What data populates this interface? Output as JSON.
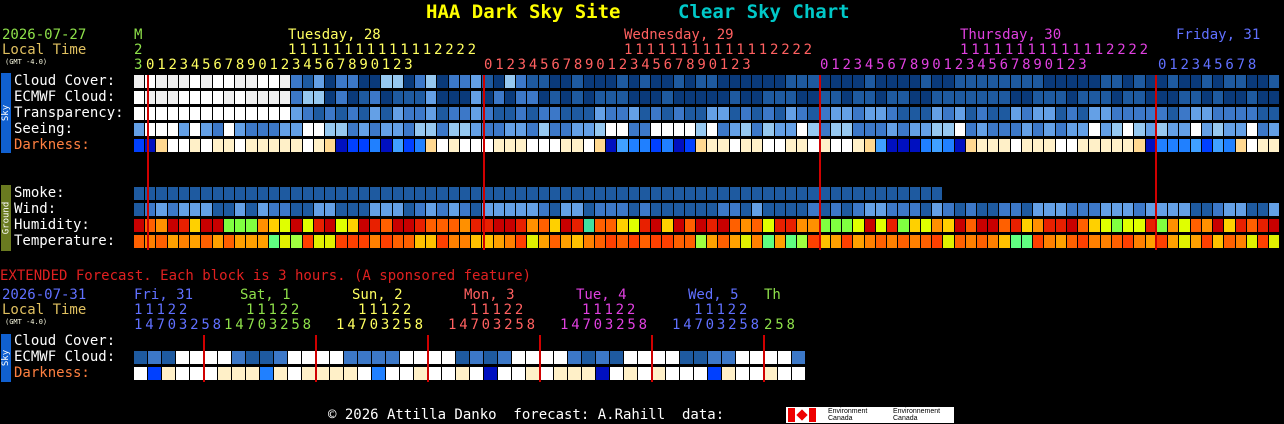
{
  "header": {
    "site_title": "HAA Dark Sky Site",
    "chart_title": "Clear Sky Chart",
    "title_color": "#ffff00",
    "chart_title_color": "#00c8c8"
  },
  "main": {
    "date": "2026-07-27",
    "local_time_label": "Local Time",
    "gmt_offset": "(GMT -4.0)",
    "day_labels": [
      {
        "text": "M",
        "color": "#8ee04a"
      },
      {
        "text": "Tuesday, 28",
        "color": "#ffff60"
      },
      {
        "text": "Wednesday, 29",
        "color": "#ff6060"
      },
      {
        "text": "Thursday, 30",
        "color": "#e040e0"
      },
      {
        "text": "Friday, 31",
        "color": "#6070ff"
      }
    ],
    "hour_tens": [
      {
        "text": "2",
        "color": "#8ee04a"
      },
      {
        "text": "11111111111112222",
        "color": "#ffff60"
      },
      {
        "text": "11111111111112222",
        "color": "#ff6060"
      },
      {
        "text": "11111111111112222",
        "color": "#e040e0"
      }
    ],
    "hour_ones": [
      {
        "text": "3",
        "color": "#8ee04a"
      },
      {
        "text": "012345678901234567890123",
        "color": "#ffff60"
      },
      {
        "text": "012345678901234567890123",
        "color": "#ff6060"
      },
      {
        "text": "012345678901234567890123",
        "color": "#e040e0"
      },
      {
        "text": "012345678",
        "color": "#6070ff"
      }
    ],
    "sky_side_label": "Sky",
    "ground_side_label": "Ground",
    "rows": [
      {
        "label": "Cloud Cover:",
        "color": "#ffffff"
      },
      {
        "label": "ECMWF Cloud:",
        "color": "#ffffff"
      },
      {
        "label": "Transparency:",
        "color": "#ffffff"
      },
      {
        "label": "Seeing:",
        "color": "#ffffff"
      },
      {
        "label": "Darkness:",
        "color": "#ff8040"
      }
    ],
    "ground_rows": [
      {
        "label": "Smoke:"
      },
      {
        "label": "Wind:"
      },
      {
        "label": "Humidity:"
      },
      {
        "label": "Temperature:"
      }
    ]
  },
  "extended": {
    "note": "EXTENDED Forecast. Each block is 3 hours. (A sponsored feature)",
    "date": "2026-07-31",
    "local_time_label": "Local Time",
    "gmt_offset": "(GMT -4.0)",
    "day_labels": [
      {
        "text": "Fri, 31",
        "color": "#6070ff"
      },
      {
        "text": "Sat, 1",
        "color": "#8ee04a"
      },
      {
        "text": "Sun, 2",
        "color": "#ffff60"
      },
      {
        "text": "Mon, 3",
        "color": "#ff6060"
      },
      {
        "text": "Tue, 4",
        "color": "#e040e0"
      },
      {
        "text": "Wed, 5",
        "color": "#6070ff"
      },
      {
        "text": "Th",
        "color": "#8ee04a"
      }
    ],
    "tens_groups": [
      {
        "text": "11122",
        "color": "#6070ff"
      },
      {
        "text": "11122",
        "color": "#8ee04a"
      },
      {
        "text": "11122",
        "color": "#ffff60"
      },
      {
        "text": "11122",
        "color": "#ff6060"
      },
      {
        "text": "11122",
        "color": "#e040e0"
      },
      {
        "text": "11122",
        "color": "#6070ff"
      }
    ],
    "ones_groups": [
      {
        "text": "14703258",
        "color": "#6070ff"
      },
      {
        "text": "14703258",
        "color": "#8ee04a"
      },
      {
        "text": "14703258",
        "color": "#ffff60"
      },
      {
        "text": "14703258",
        "color": "#ff6060"
      },
      {
        "text": "14703258",
        "color": "#e040e0"
      },
      {
        "text": "14703258",
        "color": "#6070ff"
      },
      {
        "text": "258",
        "color": "#8ee04a"
      }
    ],
    "rows": [
      {
        "label": "Cloud Cover:"
      },
      {
        "label": "ECMWF Cloud:"
      },
      {
        "label": "Darkness:"
      }
    ]
  },
  "footer": {
    "text": "© 2026 Attilla Danko  forecast: A.Rahill  data:",
    "logo_en": "Environment\nCanada",
    "logo_fr": "Environnement\nCanada"
  },
  "palette": {
    "cloud_clear": "#0a3a7a",
    "cloud_scale": [
      "#0a3a7a",
      "#1e5aa0",
      "#3c78c8",
      "#64a0e6",
      "#96c8f0",
      "#c8e6f0",
      "#f0f0f0",
      "#ffffff"
    ],
    "darkness": [
      "#000000",
      "#0010c0",
      "#0040ff",
      "#2080ff",
      "#40a0ff",
      "#80c8ff",
      "#ffd890",
      "#fff0c8",
      "#ffffff"
    ],
    "humidity": [
      "#c80000",
      "#e82000",
      "#ff6000",
      "#ff9000",
      "#ffd000",
      "#e0ff00",
      "#80ff40",
      "#40e0a0"
    ],
    "temperature": [
      "#ff4000",
      "#ff6000",
      "#ff8000",
      "#ffa000",
      "#ffc000",
      "#e0f000",
      "#a0ff40",
      "#60ff80"
    ],
    "day_separator": "#d00000"
  }
}
